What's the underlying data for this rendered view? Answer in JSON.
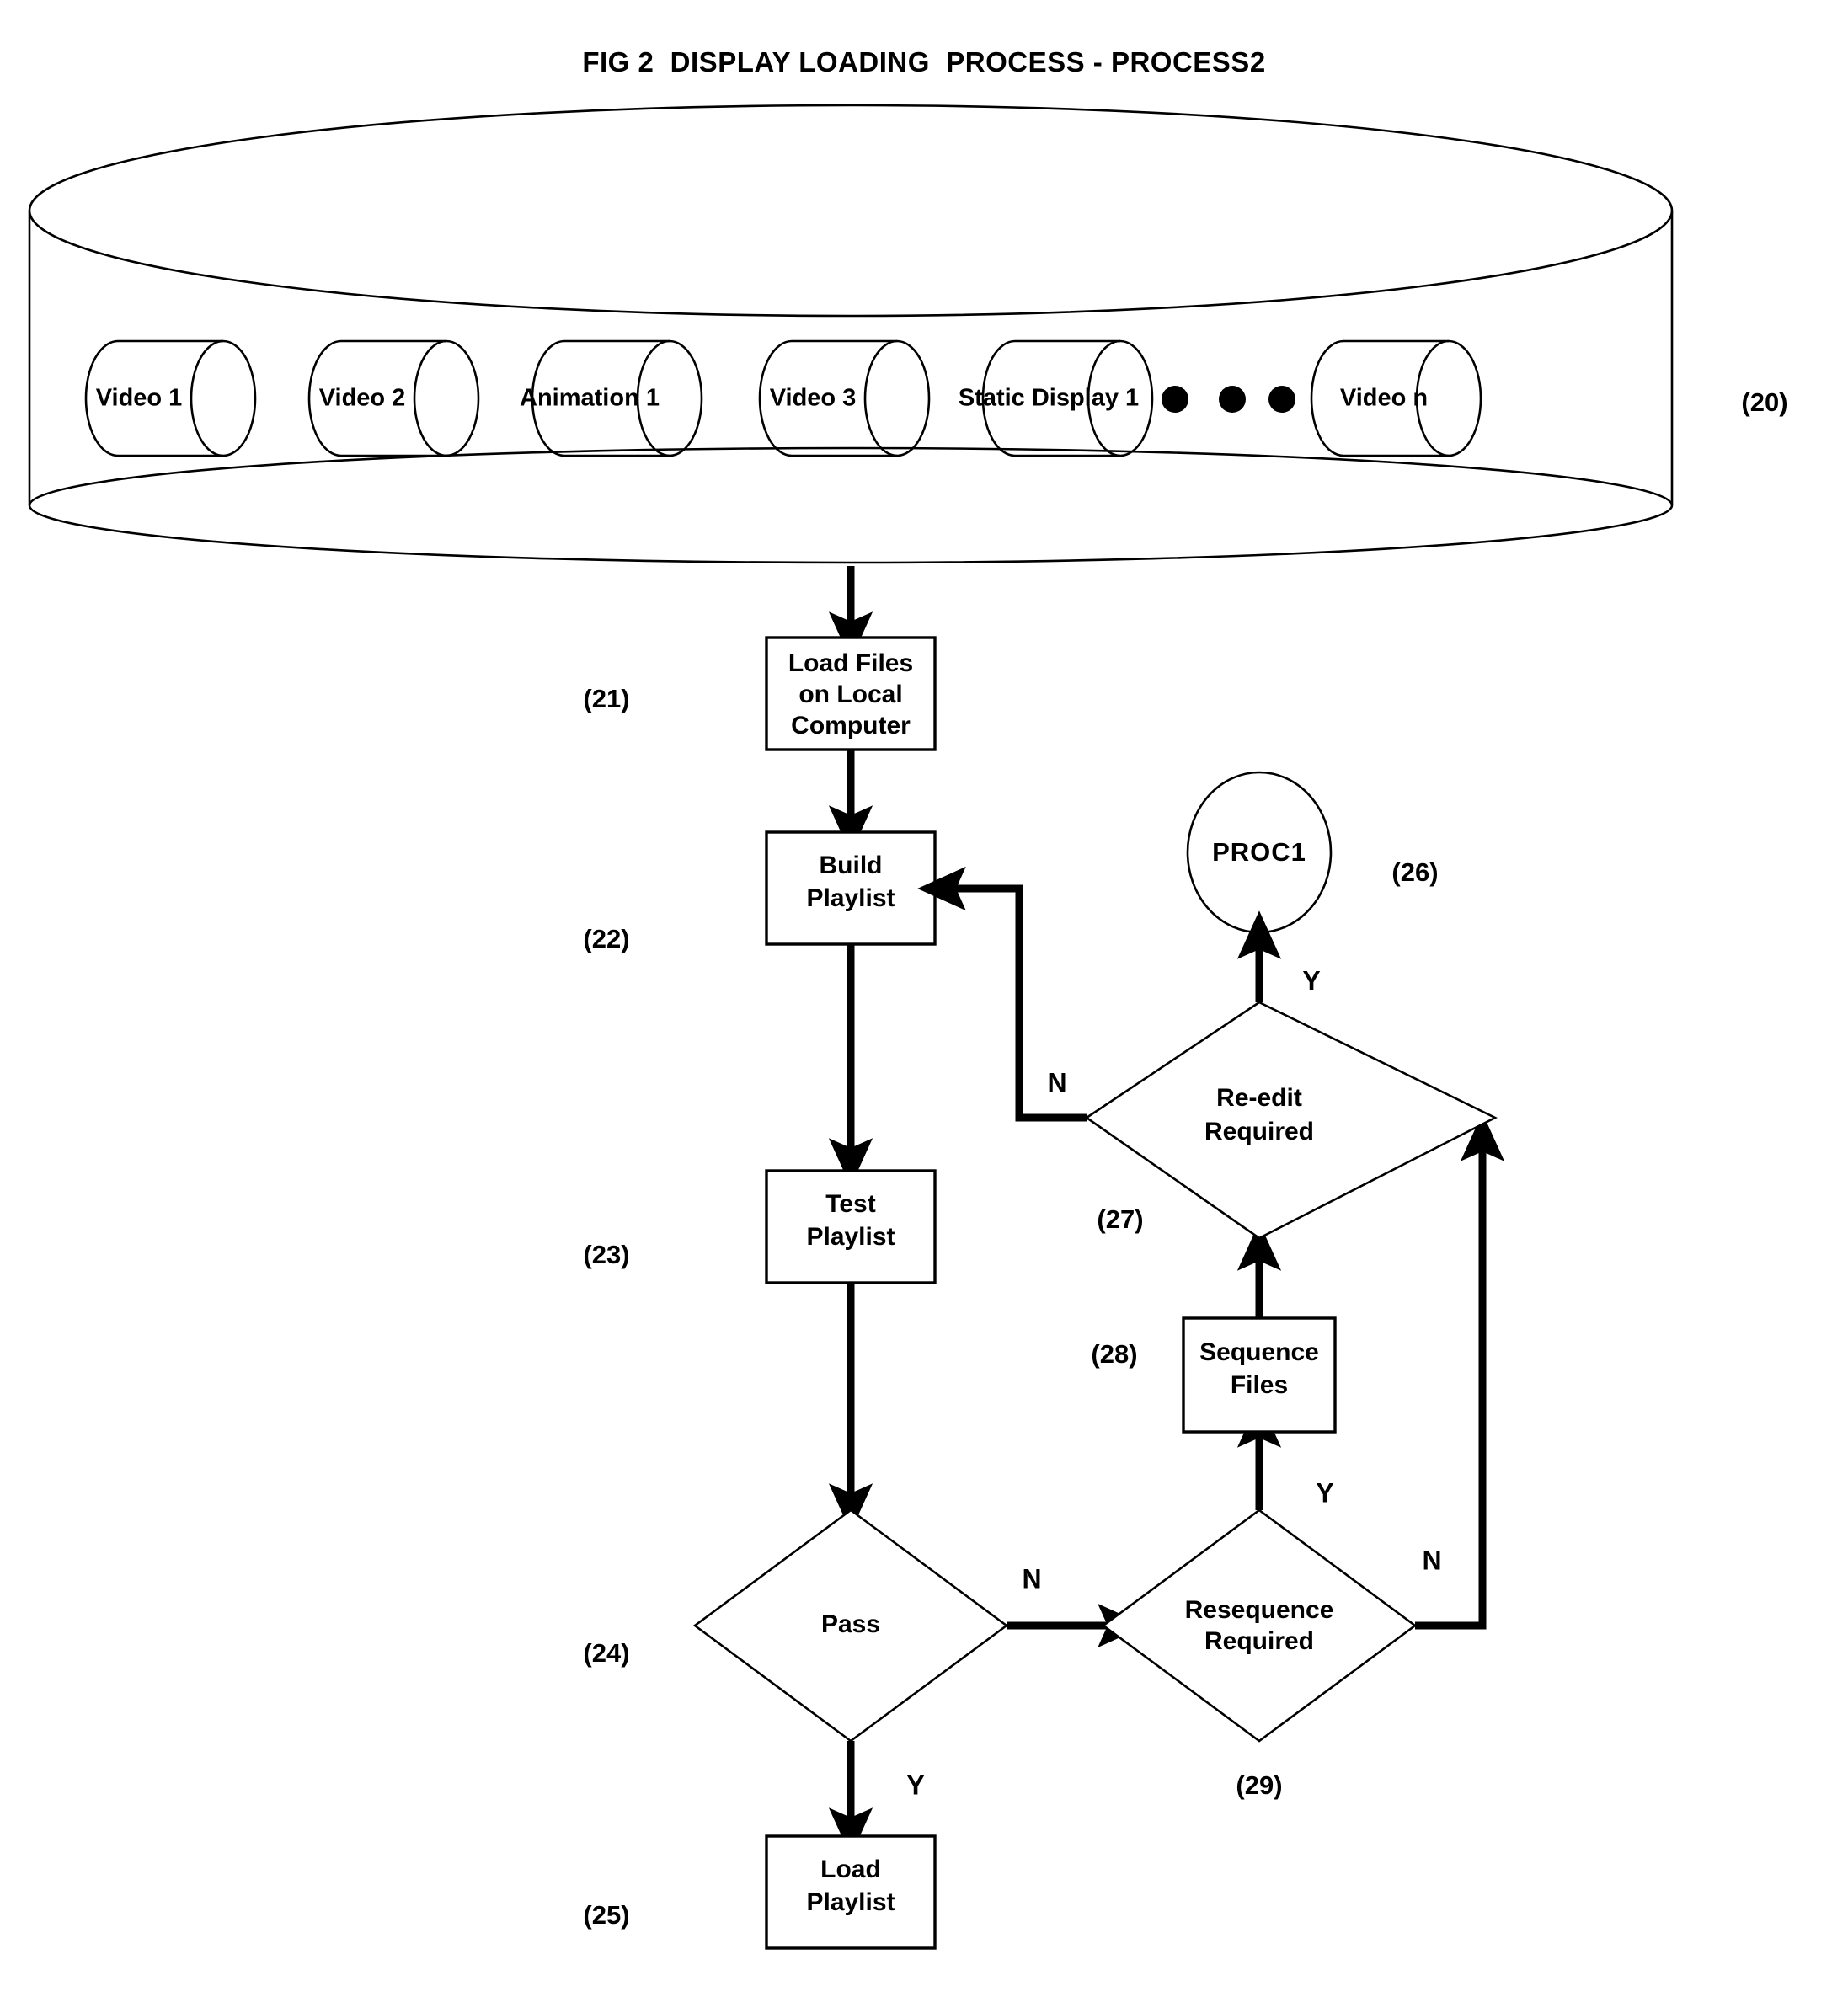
{
  "figure": {
    "title": "FIG 2  DISPLAY LOADING  PROCESS - PROCESS2"
  },
  "content_store": {
    "ref": "(20)",
    "items": [
      {
        "label": "Video 1"
      },
      {
        "label": "Video 2"
      },
      {
        "label": "Animation 1"
      },
      {
        "label": "Video 3"
      },
      {
        "label": "Static Display 1"
      },
      {
        "label": "Video n"
      }
    ],
    "ellipsis": "● ● ●"
  },
  "nodes": {
    "load_files": {
      "ref": "(21)",
      "line1": "Load Files",
      "line2": "on Local",
      "line3": "Computer"
    },
    "build_playlist": {
      "ref": "(22)",
      "line1": "Build",
      "line2": "Playlist"
    },
    "test_playlist": {
      "ref": "(23)",
      "line1": "Test",
      "line2": "Playlist"
    },
    "pass": {
      "ref": "(24)",
      "line1": "Pass"
    },
    "load_playlist": {
      "ref": "(25)",
      "line1": "Load",
      "line2": "Playlist"
    },
    "proc1": {
      "ref": "(26)",
      "line1": "PROC1"
    },
    "re_edit_required": {
      "ref": "(27)",
      "line1": "Re-edit",
      "line2": "Required"
    },
    "sequence_files": {
      "ref": "(28)",
      "line1": "Sequence",
      "line2": "Files"
    },
    "resequence_required": {
      "ref": "(29)",
      "line1": "Resequence",
      "line2": "Required"
    }
  },
  "branches": {
    "re_edit_yes": "Y",
    "re_edit_no": "N",
    "pass_no": "N",
    "pass_yes": "Y",
    "resequence_yes": "Y",
    "resequence_no": "N"
  },
  "colors": {
    "stroke": "#000000",
    "background": "#ffffff"
  }
}
